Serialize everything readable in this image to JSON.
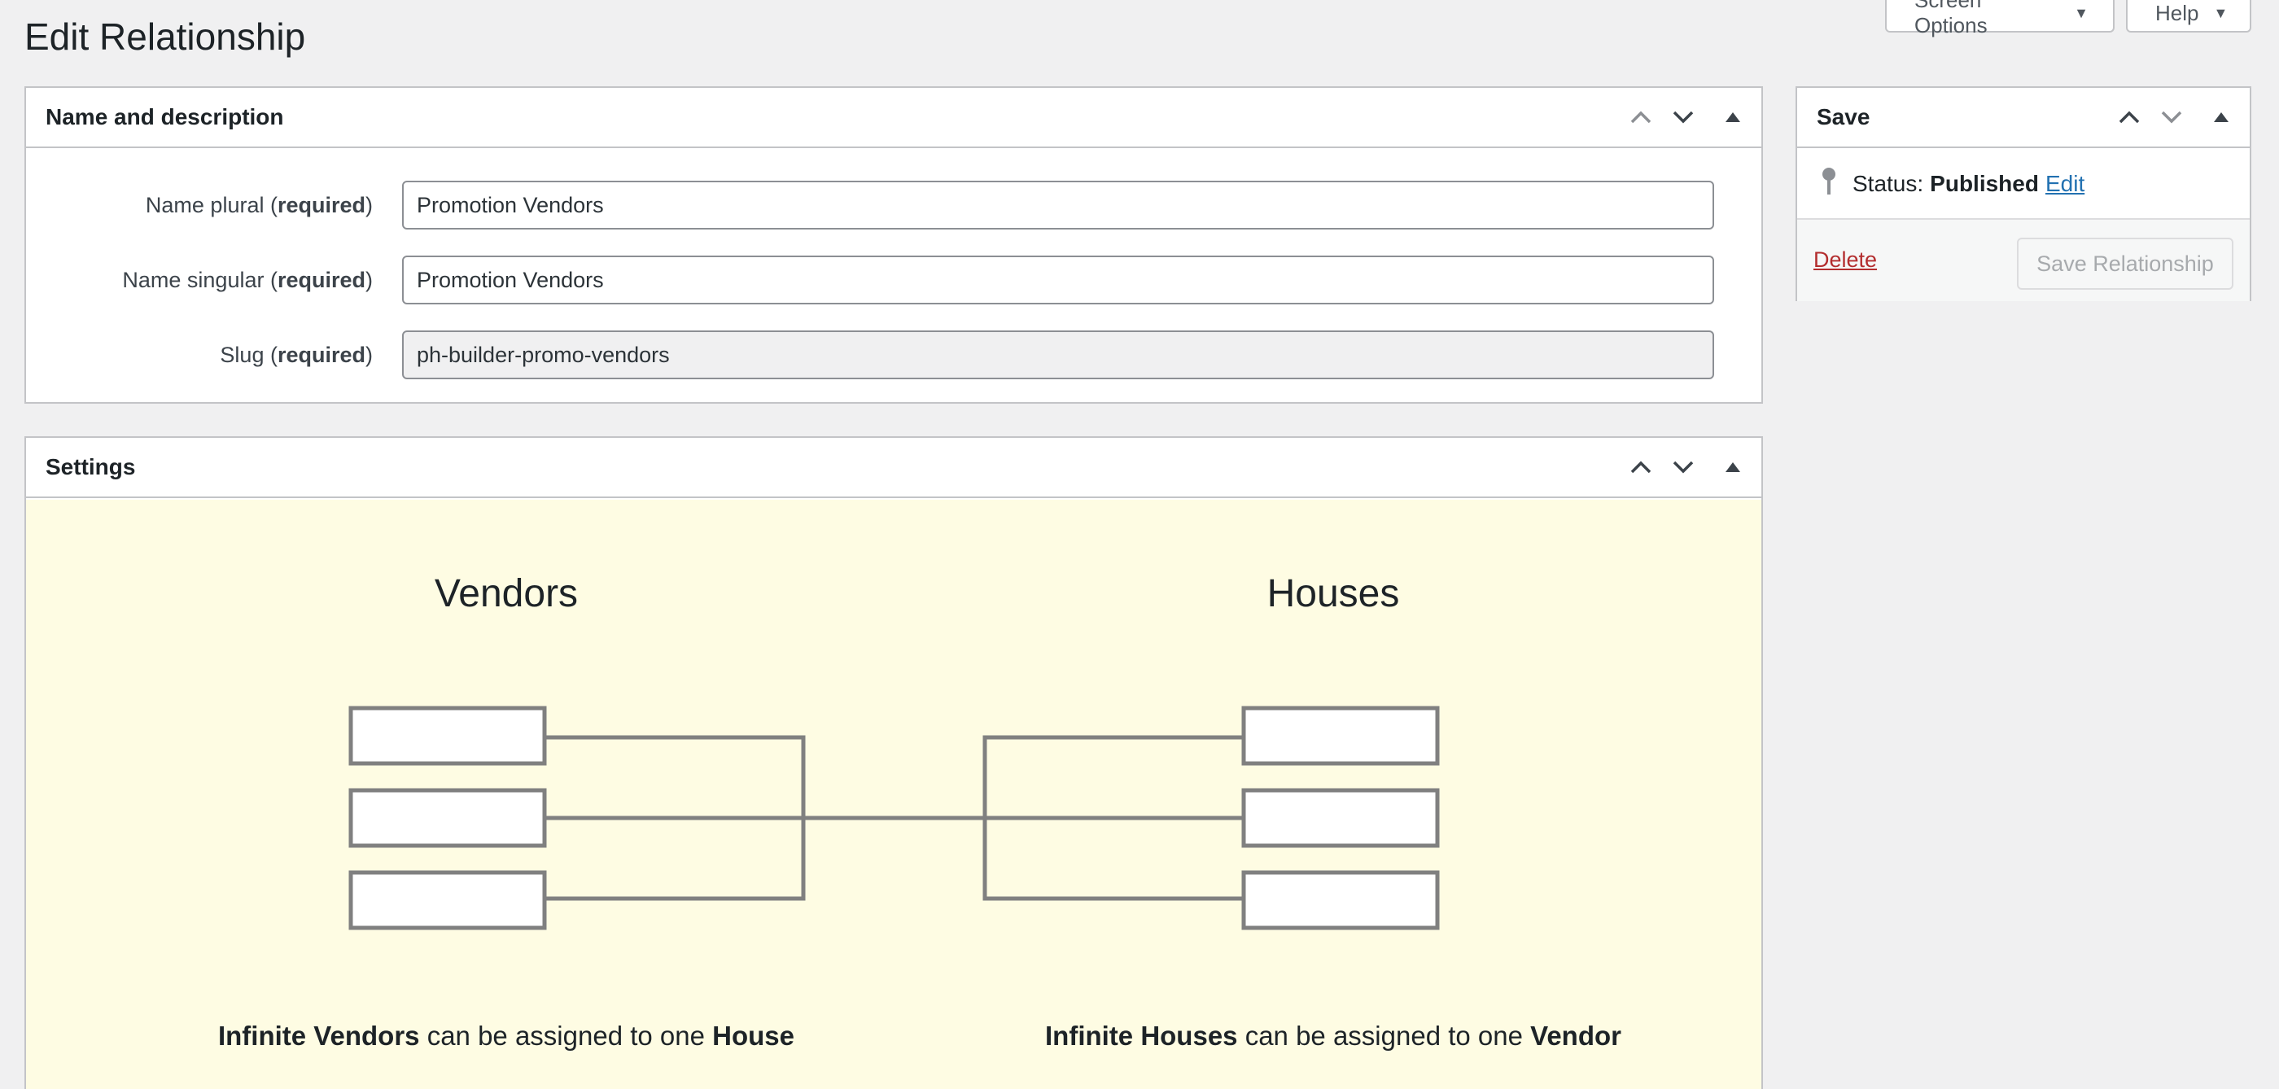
{
  "header": {
    "title": "Edit Relationship",
    "screen_options_label": "Screen Options",
    "help_label": "Help"
  },
  "name_box": {
    "title": "Name and description",
    "fields": [
      {
        "label": "Name plural (",
        "req": "required",
        "close": ")",
        "value": "Promotion Vendors"
      },
      {
        "label": "Name singular (",
        "req": "required",
        "close": ")",
        "value": "Promotion Vendors"
      },
      {
        "label": "Slug (",
        "req": "required",
        "close": ")",
        "value": "ph-builder-promo-vendors"
      }
    ]
  },
  "settings_box": {
    "title": "Settings",
    "left_heading": "Vendors",
    "right_heading": "Houses",
    "left_caption": {
      "a": "Infinite Vendors",
      "b": " can be assigned to one ",
      "c": "House"
    },
    "right_caption": {
      "a": "Infinite Houses",
      "b": " can be assigned to one ",
      "c": "Vendor"
    }
  },
  "save_box": {
    "title": "Save",
    "status_label": "Status:",
    "status_value": "Published",
    "edit_link": "Edit",
    "delete_label": "Delete",
    "save_button": "Save Relationship"
  },
  "icons": {
    "up": "chevron-up-icon",
    "down": "chevron-down-icon",
    "toggle": "triangle-up-icon",
    "pin": "pushpin-icon",
    "caret": "caret-down-icon"
  },
  "colors": {
    "page_bg": "#f0f0f1",
    "link": "#2271b1",
    "delete": "#b32d2e",
    "settings_bg": "#fefce3",
    "diagram_stroke": "#808080"
  }
}
